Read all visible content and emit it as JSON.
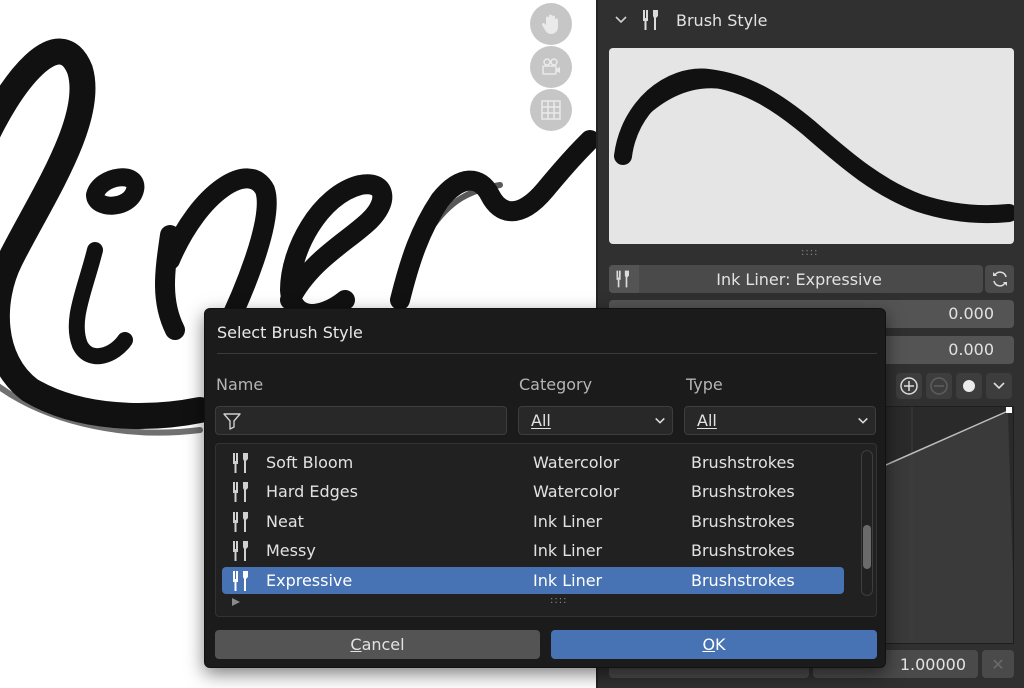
{
  "panel": {
    "header_title": "Brush Style",
    "brush_name": "Ink Liner: Expressive",
    "field_1": "0.000",
    "field_2": "0.000",
    "bottom_value": "1.00000"
  },
  "dialog": {
    "title": "Select Brush Style",
    "columns": {
      "name": "Name",
      "category": "Category",
      "type": "Type"
    },
    "filter_placeholder": "",
    "category_filter": "All",
    "type_filter": "All",
    "rows": [
      {
        "name": "Soft Bloom",
        "category": "Watercolor",
        "type": "Brushstrokes",
        "selected": false
      },
      {
        "name": "Hard Edges",
        "category": "Watercolor",
        "type": "Brushstrokes",
        "selected": false
      },
      {
        "name": "Neat",
        "category": "Ink Liner",
        "type": "Brushstrokes",
        "selected": false
      },
      {
        "name": "Messy",
        "category": "Ink Liner",
        "type": "Brushstrokes",
        "selected": false
      },
      {
        "name": "Expressive",
        "category": "Ink Liner",
        "type": "Brushstrokes",
        "selected": true
      }
    ],
    "cancel_label_first": "C",
    "cancel_label_rest": "ancel",
    "ok_label_first": "O",
    "ok_label_rest": "K"
  },
  "colors": {
    "accent": "#4772b3",
    "dialog_bg": "#1b1b1b",
    "panel_bg": "#303030"
  },
  "icons": [
    "hand-icon",
    "camera-icon",
    "grid-icon",
    "brush-icon",
    "refresh-icon",
    "filter-icon",
    "chevron-down-icon",
    "zoom-in-icon",
    "zoom-out-icon"
  ]
}
